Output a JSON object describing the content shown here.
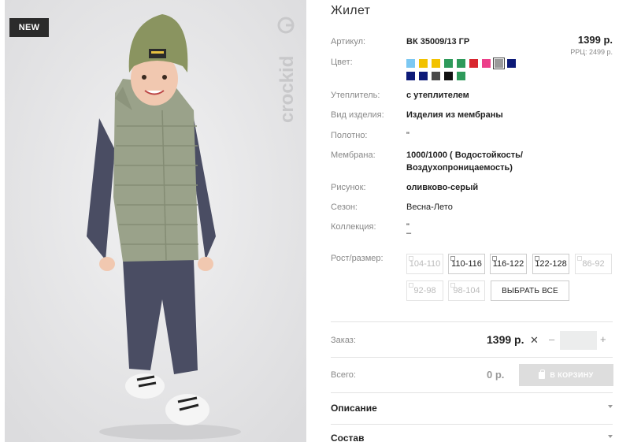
{
  "badge": "NEW",
  "brand_logo_text": "crockid",
  "product": {
    "title": "Жилет"
  },
  "price": {
    "main": "1399 р.",
    "rrp": "РРЦ: 2499 р."
  },
  "details": [
    {
      "label": "Артикул:",
      "value": "ВК 35009/13 ГР",
      "bold": true
    },
    {
      "label": "Цвет:",
      "value": ""
    },
    {
      "label": "Утеплитель:",
      "value": "с утеплителем",
      "bold": true
    },
    {
      "label": "Вид изделия:",
      "value": "Изделия из мембраны",
      "bold": true
    },
    {
      "label": "Полотно:",
      "value": "\"",
      "bold": false
    },
    {
      "label": "Мембрана:",
      "value": "1000/1000 ( Водостойкость/",
      "value2": "Воздухопроницаемость)",
      "bold": true
    },
    {
      "label": "Рисунок:",
      "value": "оливково-серый",
      "bold": true
    },
    {
      "label": "Сезон:",
      "value": "Весна-Лето",
      "bold": false
    },
    {
      "label": "Коллекция:",
      "value": "\"",
      "value2": "–",
      "bold": false
    }
  ],
  "colors": [
    "#7cc8f2",
    "#f2c200",
    "#f2c200",
    "#2e9a5a",
    "#2e9a5a",
    "#d8262e",
    "#ec3f8a",
    "#9a9a9a",
    "#0d1a78",
    "#0d1a78",
    "#0d1a78",
    "#4a4a4a",
    "#111111",
    "#2e9a5a"
  ],
  "selected_color_index": 7,
  "sizes": {
    "label": "Рост/размер:",
    "options": [
      {
        "label": "104-110",
        "available": false
      },
      {
        "label": "110-116",
        "available": true
      },
      {
        "label": "116-122",
        "available": true
      },
      {
        "label": "122-128",
        "available": true
      },
      {
        "label": "86-92",
        "available": false
      },
      {
        "label": "92-98",
        "available": false
      },
      {
        "label": "98-104",
        "available": false
      }
    ],
    "select_all": "ВЫБРАТЬ ВСЕ"
  },
  "order": {
    "label": "Заказ:",
    "price": "1399 р.",
    "x": "✕",
    "minus": "–",
    "plus": "+",
    "qty": ""
  },
  "total": {
    "label": "Всего:",
    "value": "0 р.",
    "cart_button": "В КОРЗИНУ"
  },
  "sections": [
    {
      "label": "Описание"
    },
    {
      "label": "Состав"
    }
  ]
}
